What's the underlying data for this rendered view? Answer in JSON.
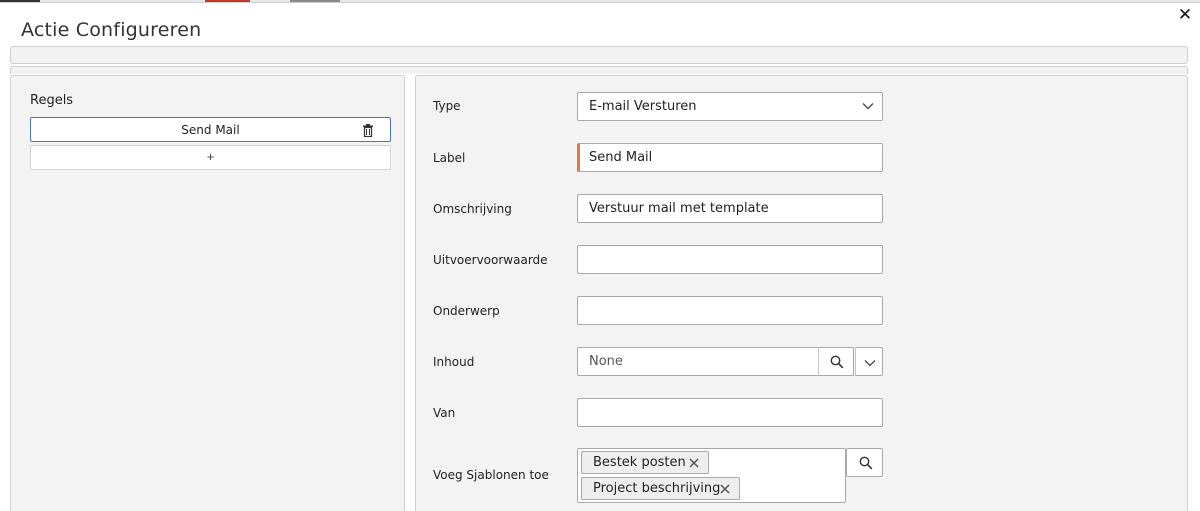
{
  "dialog": {
    "title": "Actie Configureren",
    "close_icon": "close-icon"
  },
  "rules": {
    "heading": "Regels",
    "items": [
      {
        "label": "Send Mail",
        "icon": "trash-icon"
      }
    ],
    "add_label": "+"
  },
  "form": {
    "type": {
      "label": "Type",
      "value": "E-mail Versturen"
    },
    "label_field": {
      "label": "Label",
      "value": "Send Mail"
    },
    "omschrijving": {
      "label": "Omschrijving",
      "value": "Verstuur mail met template"
    },
    "uitvoervoorwaarde": {
      "label": "Uitvoervoorwaarde",
      "value": ""
    },
    "onderwerp": {
      "label": "Onderwerp",
      "value": ""
    },
    "inhoud": {
      "label": "Inhoud",
      "value": "None"
    },
    "van": {
      "label": "Van",
      "value": ""
    },
    "sjablonen": {
      "label": "Voeg Sjablonen toe",
      "tags": [
        "Bestek posten",
        "Project beschrijving"
      ]
    }
  },
  "colors": {
    "required_accent": "#e07a3f",
    "selected_border": "#4a74c9"
  }
}
